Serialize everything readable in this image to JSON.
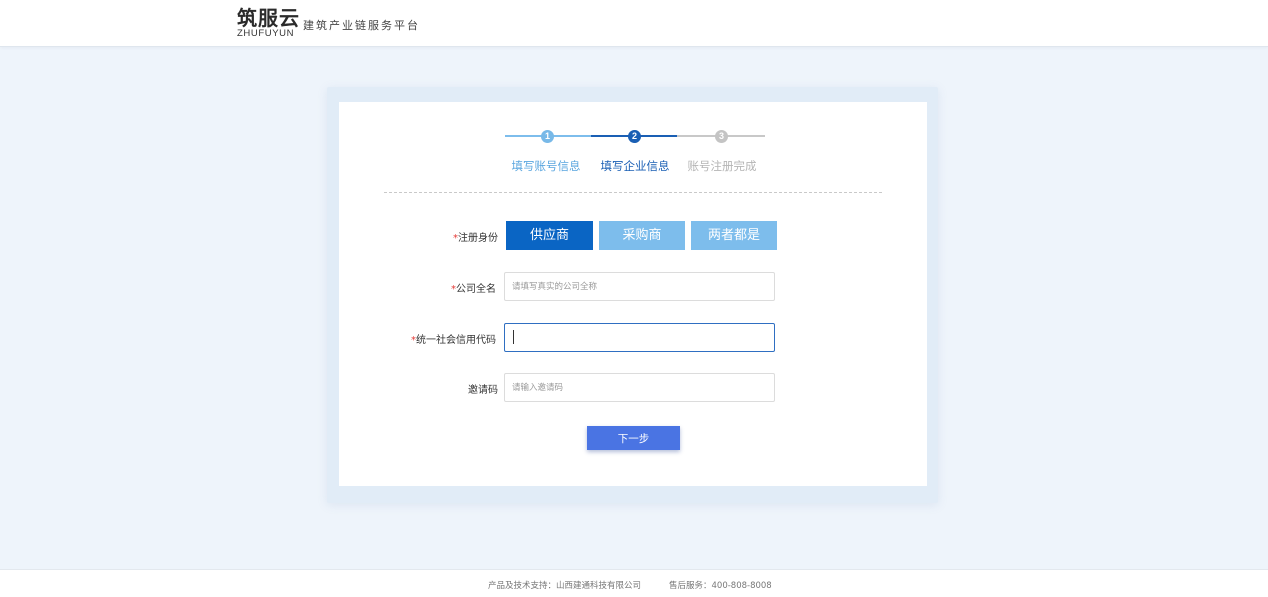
{
  "header": {
    "logo_cn": "筑服云",
    "logo_en": "ZHUFUYUN",
    "slogan": "建筑产业链服务平台"
  },
  "steps": {
    "items": [
      {
        "number": "1",
        "label": "填写账号信息",
        "status": "done"
      },
      {
        "number": "2",
        "label": "填写企业信息",
        "status": "active"
      },
      {
        "number": "3",
        "label": "账号注册完成",
        "status": "pending"
      }
    ]
  },
  "form": {
    "role": {
      "required_mark": "*",
      "label": "注册身份",
      "options": [
        "供应商",
        "采购商",
        "两者都是"
      ],
      "selected": "供应商"
    },
    "company_name": {
      "required_mark": "*",
      "label": "公司全名",
      "placeholder": "请填写真实的公司全称",
      "value": ""
    },
    "credit_code": {
      "required_mark": "*",
      "label": "统一社会信用代码",
      "placeholder": "",
      "value": ""
    },
    "invite_code": {
      "label": "邀请码",
      "placeholder": "请输入邀请码",
      "value": ""
    },
    "next_label": "下一步"
  },
  "footer": {
    "support": "产品及技术支持：山西建通科技有限公司",
    "service": "售后服务：400-808-8008"
  },
  "colors": {
    "primary": "#0a65c4",
    "primary_light": "#7dbdec",
    "step_done": "#78b9e8",
    "step_active": "#1a5fb4",
    "step_pending": "#c4c4c4",
    "next_button": "#4a74e3",
    "required": "#e53935",
    "background": "#eef4fb"
  }
}
